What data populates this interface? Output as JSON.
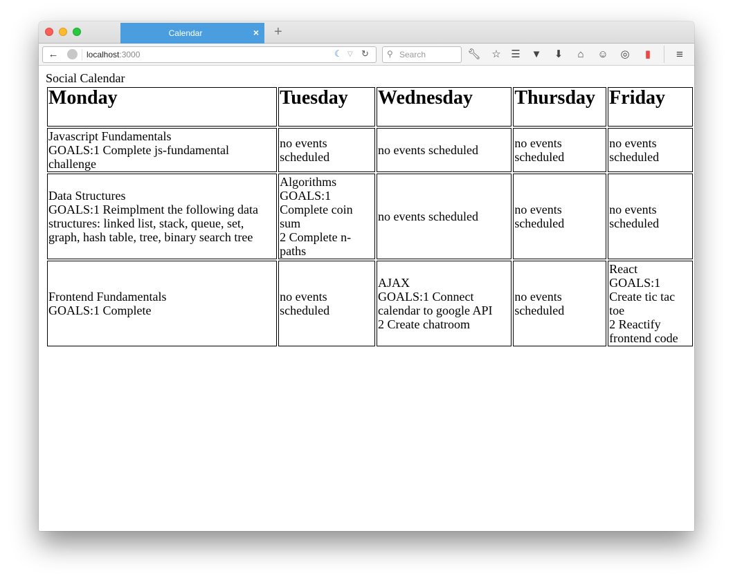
{
  "browser": {
    "tab_title": "Calendar",
    "tab_close": "×",
    "new_tab": "+",
    "url_host": "localhost",
    "url_port": ":3000",
    "search_placeholder": "Search"
  },
  "page": {
    "heading": "Social Calendar"
  },
  "calendar": {
    "days": [
      "Monday",
      "Tuesday",
      "Wednesday",
      "Thursday",
      "Friday"
    ],
    "rows": [
      [
        [
          "Javascript Fundamentals",
          "GOALS:1 Complete js-fundamental challenge"
        ],
        [
          "no events scheduled"
        ],
        [
          "no events scheduled"
        ],
        [
          "no events scheduled"
        ],
        [
          "no events scheduled"
        ]
      ],
      [
        [
          "Data Structures",
          "GOALS:1 Reimplment the following data structures: linked list, stack, queue, set, graph, hash table, tree, binary search tree"
        ],
        [
          "Algorithms",
          "GOALS:1 Complete coin sum",
          "2 Complete n-paths"
        ],
        [
          "no events scheduled"
        ],
        [
          "no events scheduled"
        ],
        [
          "no events scheduled"
        ]
      ],
      [
        [
          "Frontend Fundamentals",
          "GOALS:1 Complete"
        ],
        [
          "no events scheduled"
        ],
        [
          "AJAX",
          "GOALS:1 Connect calendar to google API",
          "2 Create chatroom"
        ],
        [
          "no events scheduled"
        ],
        [
          "React",
          "GOALS:1 Create tic tac toe",
          "2 Reactify frontend code"
        ]
      ]
    ]
  }
}
